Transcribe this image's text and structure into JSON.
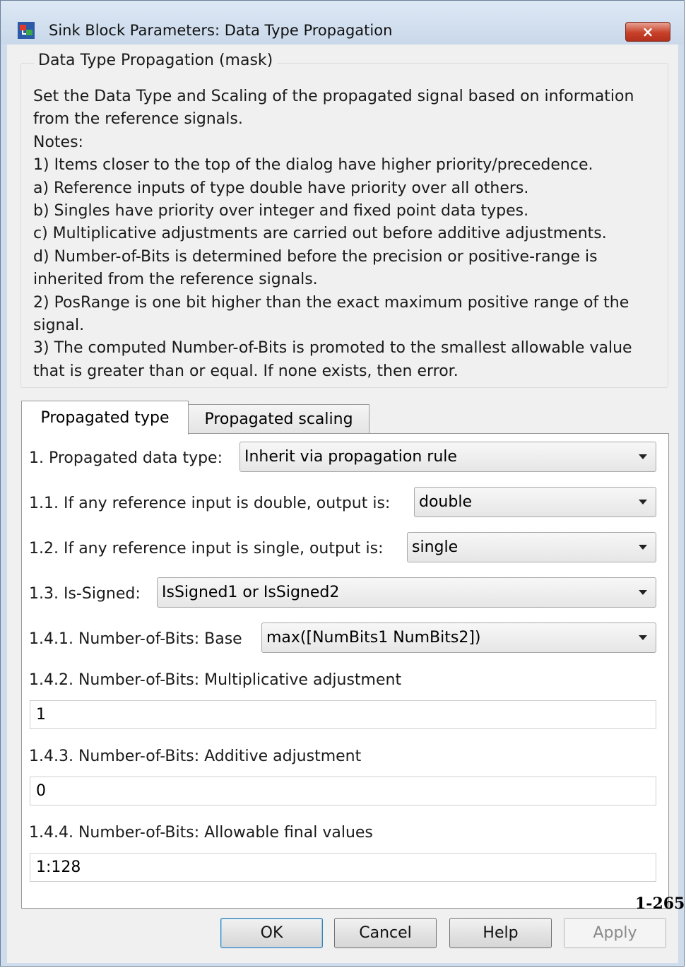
{
  "window": {
    "title": "Sink Block Parameters: Data Type Propagation",
    "close_glyph": "×"
  },
  "mask": {
    "legend": "Data Type Propagation (mask)",
    "description_lines": [
      "Set the Data Type and Scaling of the propagated signal based on information",
      "from the reference signals.",
      "Notes:",
      "1) Items closer to the top of the dialog have higher priority/precedence.",
      "a) Reference inputs of type double have priority over all others.",
      "b) Singles have priority over integer and fixed point data types.",
      "c) Multiplicative adjustments are carried out before additive adjustments.",
      "d) Number-of-Bits is determined before the precision or positive-range is",
      "inherited from the reference signals.",
      "2) PosRange is one bit higher than the exact maximum positive range of the",
      "signal.",
      "3) The computed Number-of-Bits is promoted to the smallest allowable value",
      "that is greater than or equal.  If none exists, then error."
    ]
  },
  "tabs": [
    {
      "label": "Propagated type",
      "active": true
    },
    {
      "label": "Propagated scaling",
      "active": false
    }
  ],
  "params": {
    "p1_label": "1. Propagated data type:",
    "p1_value": "Inherit via propagation rule",
    "p11_label": "1.1. If any reference input is double, output is:",
    "p11_value": "double",
    "p12_label": "1.2. If any reference input is single, output is:",
    "p12_value": "single",
    "p13_label": "1.3. Is-Signed:",
    "p13_value": "IsSigned1 or IsSigned2",
    "p141_label": "1.4.1. Number-of-Bits: Base",
    "p141_value": "max([NumBits1 NumBits2])",
    "p142_label": "1.4.2. Number-of-Bits: Multiplicative adjustment",
    "p142_value": "1",
    "p143_label": "1.4.3. Number-of-Bits: Additive adjustment",
    "p143_value": "0",
    "p144_label": "1.4.4. Number-of-Bits: Allowable final values",
    "p144_value": "1:128"
  },
  "buttons": {
    "ok": "OK",
    "cancel": "Cancel",
    "help": "Help",
    "apply": "Apply"
  },
  "page_number": "1-265"
}
